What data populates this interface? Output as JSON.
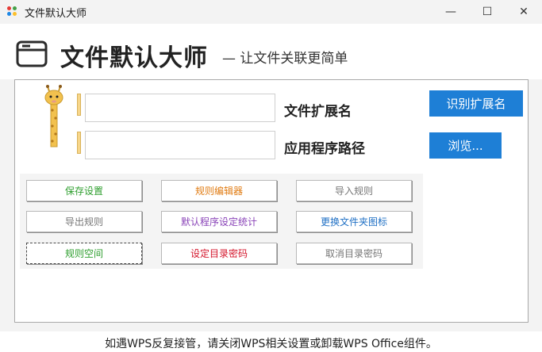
{
  "window": {
    "title": "文件默认大师",
    "minimize": "—",
    "maximize": "☐",
    "close": "✕"
  },
  "header": {
    "heading": "文件默认大师",
    "slogan": "— 让文件关联更简单"
  },
  "form": {
    "extension_label": "文件扩展名",
    "extension_value": "",
    "path_label": "应用程序路径",
    "path_value": "",
    "identify_button": "识别扩展名",
    "browse_button": "浏览..."
  },
  "buttons": [
    {
      "label": "保存设置",
      "color": "#2e9e2e"
    },
    {
      "label": "规则编辑器",
      "color": "#e07b12"
    },
    {
      "label": "导入规则",
      "color": "#777777"
    },
    {
      "label": "导出规则",
      "color": "#777777"
    },
    {
      "label": "默认程序设定统计",
      "color": "#8a44b8"
    },
    {
      "label": "更换文件夹图标",
      "color": "#1e6fc4"
    },
    {
      "label": "规则空间",
      "color": "#2e9e2e"
    },
    {
      "label": "设定目录密码",
      "color": "#d4152b"
    },
    {
      "label": "取消目录密码",
      "color": "#777777"
    }
  ],
  "footer": {
    "note": "如遇WPS反复接管，请关闭WPS相关设置或卸载WPS Office组件。"
  },
  "colors": {
    "accent": "#1e7fd6"
  }
}
